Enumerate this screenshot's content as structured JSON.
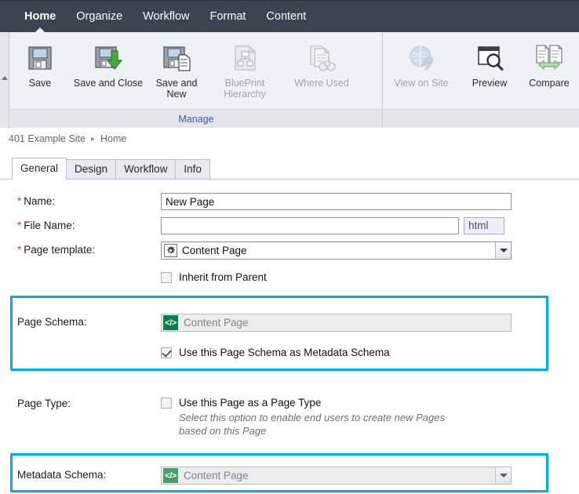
{
  "menubar": {
    "items": [
      {
        "label": "Home",
        "active": true
      },
      {
        "label": "Organize",
        "active": false
      },
      {
        "label": "Workflow",
        "active": false
      },
      {
        "label": "Format",
        "active": false
      },
      {
        "label": "Content",
        "active": false
      }
    ]
  },
  "ribbon": {
    "groups": [
      {
        "label": "Manage",
        "buttons": [
          {
            "label": "Save",
            "icon": "floppy-disk-icon",
            "enabled": true
          },
          {
            "label": "Save and Close",
            "icon": "floppy-disk-green-arrow-icon",
            "enabled": true
          },
          {
            "label": "Save and New",
            "icon": "floppy-disk-document-icon",
            "enabled": true
          },
          {
            "label": "BluePrint Hierarchy",
            "icon": "hierarchy-document-icon",
            "enabled": false
          },
          {
            "label": "Where Used",
            "icon": "documents-binoculars-icon",
            "enabled": false
          }
        ]
      },
      {
        "label": "",
        "buttons": [
          {
            "label": "View on Site",
            "icon": "globe-link-icon",
            "enabled": false
          },
          {
            "label": "Preview",
            "icon": "window-magnifier-icon",
            "enabled": true
          },
          {
            "label": "Compare",
            "icon": "documents-compare-icon",
            "enabled": false
          }
        ]
      }
    ]
  },
  "breadcrumb": {
    "root": "401 Example Site",
    "separator": "▸",
    "current": "Home"
  },
  "tabs": [
    {
      "label": "General",
      "active": true
    },
    {
      "label": "Design",
      "active": false
    },
    {
      "label": "Workflow",
      "active": false
    },
    {
      "label": "Info",
      "active": false
    }
  ],
  "form": {
    "name": {
      "label": "Name:",
      "required_marker": "*",
      "value": "New Page",
      "placeholder": ""
    },
    "file_name": {
      "label": "File Name:",
      "required_marker": "*",
      "value": "",
      "placeholder": "",
      "suffix": "html"
    },
    "page_template": {
      "label": "Page template:",
      "required_marker": "*",
      "value": "Content Page",
      "icon": "gear-icon"
    },
    "inherit_from_parent": {
      "label": "Inherit from Parent",
      "checked": false
    },
    "page_schema": {
      "label": "Page Schema:",
      "value": "Content Page",
      "icon": "code-brackets-icon",
      "disabled": true
    },
    "use_page_schema_as_metadata": {
      "label": "Use this Page Schema as Metadata Schema",
      "checked": true
    },
    "page_type": {
      "label": "Page Type:",
      "checkbox_label": "Use this Page as a Page Type",
      "checked": false,
      "hint_line1": "Select this option to enable end users to create new Pages",
      "hint_line2": "based on this Page"
    },
    "metadata_schema": {
      "label": "Metadata Schema:",
      "value": "Content Page",
      "icon": "code-brackets-icon",
      "disabled": true
    }
  },
  "highlights": {
    "color": "#00aeef",
    "boxes": [
      "page-schema-section",
      "metadata-schema-section"
    ]
  },
  "icon_glyphs": {
    "code_brackets": "</>",
    "dropdown_arrow": "▼",
    "scroll_up_arrow": "▲"
  }
}
